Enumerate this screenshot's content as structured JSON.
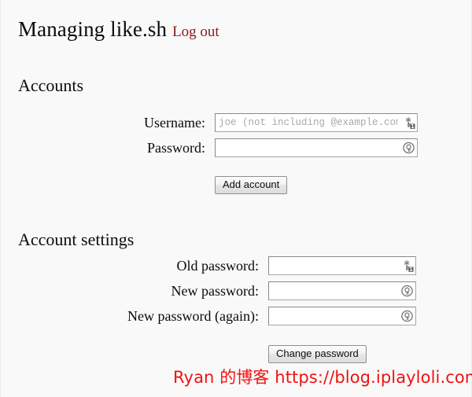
{
  "page": {
    "title": "Managing like.sh",
    "logout_label": "Log out",
    "logout_color": "#8b1a1a",
    "background_color": "#f9f9f9"
  },
  "sections": {
    "accounts": {
      "heading": "Accounts",
      "fields": [
        {
          "label": "Username:",
          "type": "text",
          "value": "",
          "placeholder": "joe (not including @example.com)",
          "icon": "key-badge-1-icon"
        },
        {
          "label": "Password:",
          "type": "password",
          "value": "",
          "placeholder": "",
          "icon": "key-circle-icon"
        }
      ],
      "submit_label": "Add account"
    },
    "account_settings": {
      "heading": "Account settings",
      "fields": [
        {
          "label": "Old password:",
          "type": "password",
          "value": "",
          "placeholder": "",
          "icon": "key-badge-1-icon"
        },
        {
          "label": "New password:",
          "type": "password",
          "value": "",
          "placeholder": "",
          "icon": "key-circle-icon"
        },
        {
          "label": "New password (again):",
          "type": "password",
          "value": "",
          "placeholder": "",
          "icon": "key-circle-icon"
        }
      ],
      "submit_label": "Change password"
    }
  },
  "watermark": {
    "text": "Ryan 的博客 https://blog.iplayloli.com",
    "color": "#f21111"
  }
}
